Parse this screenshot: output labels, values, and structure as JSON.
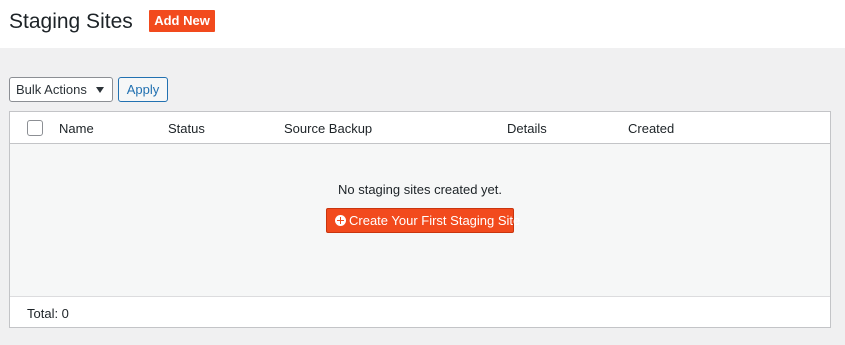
{
  "header": {
    "title": "Staging Sites",
    "add_new_label": "Add New"
  },
  "toolbar": {
    "bulk_actions_selected": "Bulk Actions",
    "apply_label": "Apply"
  },
  "table": {
    "columns": [
      "Name",
      "Status",
      "Source Backup",
      "Details",
      "Created"
    ],
    "empty_message": "No staging sites created yet.",
    "create_button_label": "Create Your First Staging Site",
    "total_label": "Total: 0"
  },
  "colors": {
    "accent": "#f24a1d",
    "link": "#2271b1"
  },
  "icons": {
    "create_button_icon": "plus-circle-icon",
    "select_caret": "caret-down-icon"
  }
}
